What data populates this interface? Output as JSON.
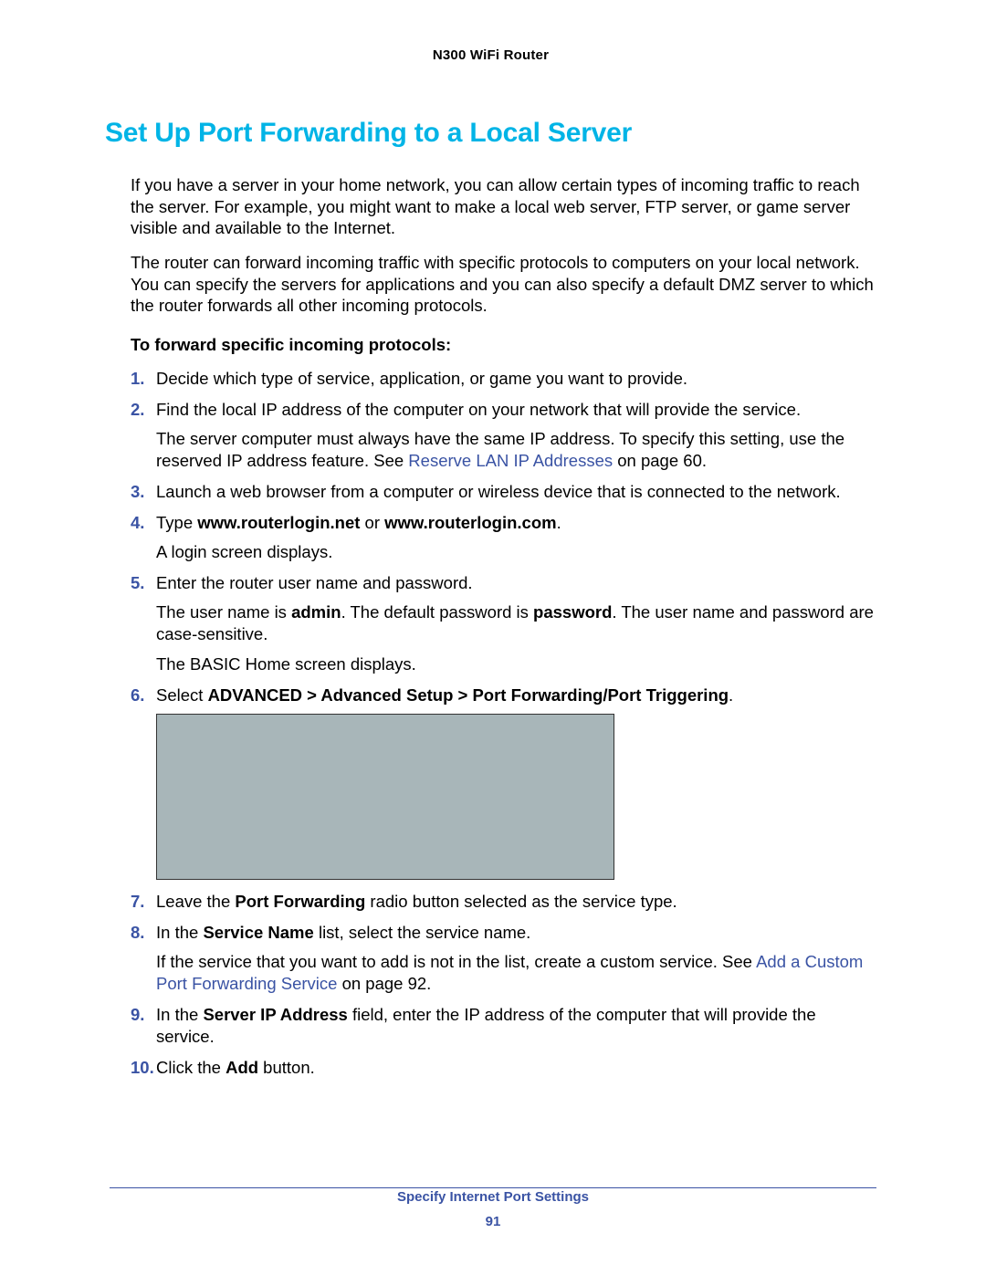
{
  "header": {
    "product": "N300 WiFi Router"
  },
  "section": {
    "heading": "Set Up Port Forwarding to a Local Server"
  },
  "intro": {
    "p1": "If you have a server in your home network, you can allow certain types of incoming traffic to reach the server. For example, you might want to make a local web server, FTP server, or game server visible and available to the Internet.",
    "p2": "The router can forward incoming traffic with specific protocols to computers on your local network. You can specify the servers for applications and you can also specify a default DMZ server to which the router forwards all other incoming protocols."
  },
  "procedure": {
    "title": "To forward specific incoming protocols:"
  },
  "steps": {
    "s1": "Decide which type of service, application, or game you want to provide.",
    "s2": "Find the local IP address of the computer on your network that will provide the service.",
    "s2_sub_a": "The server computer must always have the same IP address. To specify this setting, use the reserved IP address feature. See ",
    "s2_link": "Reserve LAN IP Addresses",
    "s2_sub_b": " on page 60.",
    "s3": "Launch a web browser from a computer or wireless device that is connected to the network.",
    "s4_a": "Type ",
    "s4_b1": "www.routerlogin.net",
    "s4_mid": " or ",
    "s4_b2": "www.routerlogin.com",
    "s4_end": ".",
    "s4_sub": "A login screen displays.",
    "s5": "Enter the router user name and password.",
    "s5_sub1_a": "The user name is ",
    "s5_sub1_b": "admin",
    "s5_sub1_c": ". The default password is ",
    "s5_sub1_d": "password",
    "s5_sub1_e": ". The user name and password are case-sensitive.",
    "s5_sub2": "The BASIC Home screen displays.",
    "s6_a": "Select ",
    "s6_b": "ADVANCED > Advanced Setup > Port Forwarding/Port Triggering",
    "s6_c": ".",
    "s7_a": "Leave the ",
    "s7_b": "Port Forwarding",
    "s7_c": " radio button selected as the service type.",
    "s8_a": "In the ",
    "s8_b": "Service Name",
    "s8_c": " list, select the service name.",
    "s8_sub_a": "If the service that you want to add is not in the list, create a custom service. See ",
    "s8_link": "Add a Custom Port Forwarding Service",
    "s8_sub_b": " on page 92.",
    "s9_a": "In the ",
    "s9_b": "Server IP Address",
    "s9_c": " field, enter the IP address of the computer that will provide the service.",
    "s10_a": "Click the ",
    "s10_b": "Add",
    "s10_c": " button."
  },
  "footer": {
    "chapter": "Specify Internet Port Settings",
    "page": "91"
  }
}
